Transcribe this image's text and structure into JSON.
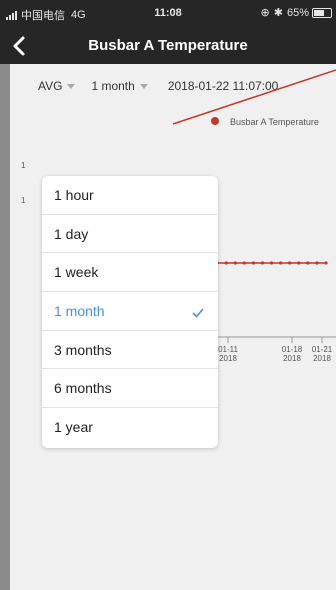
{
  "status_bar": {
    "carrier": "中国电信",
    "network": "4G",
    "time": "11:08",
    "battery": "65%",
    "battery_level": 0.65
  },
  "nav": {
    "title": "Busbar A Temperature"
  },
  "filters": {
    "aggregation": "AVG",
    "range": "1 month",
    "datetime": "2018-01-22 11:07:00"
  },
  "range_menu": {
    "items": [
      {
        "label": "1 hour",
        "selected": false
      },
      {
        "label": "1 day",
        "selected": false
      },
      {
        "label": "1 week",
        "selected": false
      },
      {
        "label": "1 month",
        "selected": true
      },
      {
        "label": "3 months",
        "selected": false
      },
      {
        "label": "6 months",
        "selected": false
      },
      {
        "label": "1 year",
        "selected": false
      }
    ]
  },
  "chart_data": {
    "type": "line",
    "legend": [
      "Busbar A Temperature"
    ],
    "x": [
      "01-11 2018",
      "01-18 2018",
      "01-21 2018"
    ],
    "series": [
      {
        "name": "Busbar A Temperature",
        "color": "#c0392b"
      }
    ],
    "partial_y_tick_digits": [
      "1",
      "1"
    ]
  },
  "colors": {
    "bar": "#262626",
    "accent": "#4a90d9",
    "series": "#c0392b",
    "background": "#f0f0f0"
  }
}
